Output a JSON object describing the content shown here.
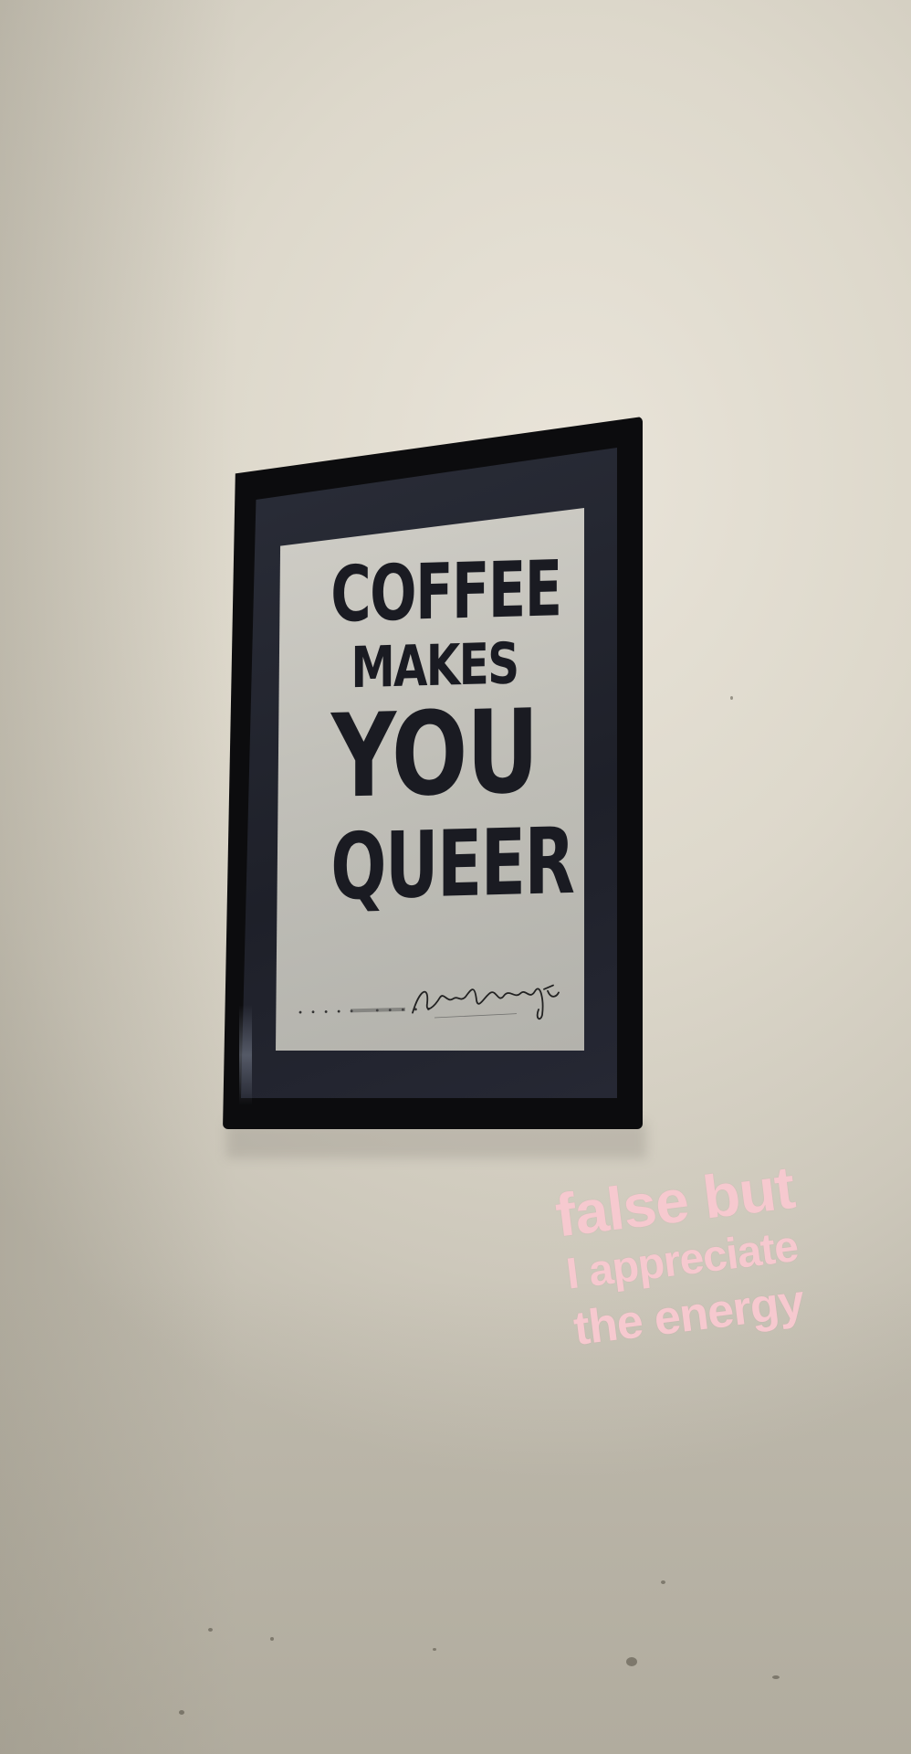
{
  "poster": {
    "line1": "COFFEE",
    "line2": "MAKES",
    "line3": "YOU",
    "line4": "QUEER",
    "signature": "Amos Paul Kennedy Jr."
  },
  "caption": {
    "line1": "false but",
    "line2": "I appreciate",
    "line3": "the energy"
  },
  "colors": {
    "wall": "#e6e2d8",
    "frame": "#0c0c0e",
    "poster_paper": "#c9c8c1",
    "poster_ink": "#1a1b22",
    "caption": "#f6c9cf"
  }
}
